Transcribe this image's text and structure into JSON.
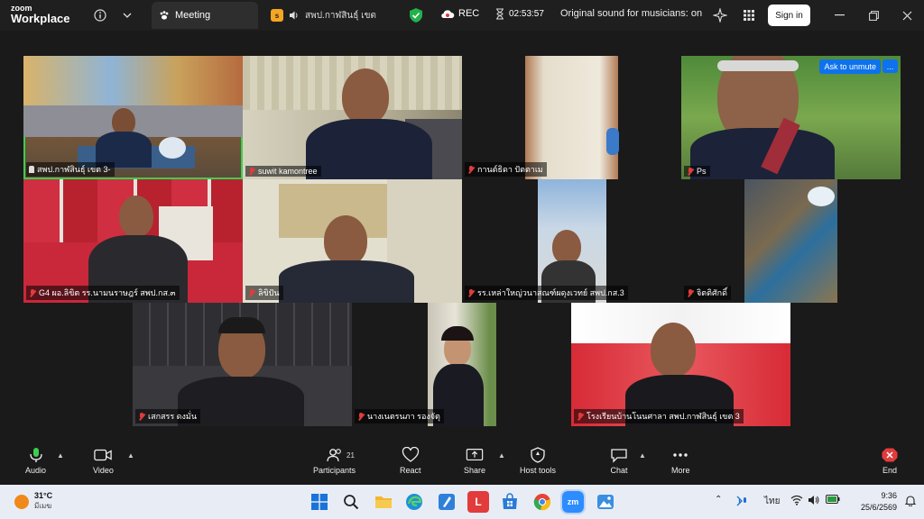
{
  "app": {
    "brand_top": "zoom",
    "brand_bottom": "Workplace"
  },
  "titlebar": {
    "meeting_tab": "Meeting",
    "share_tab": "สพป.กาฬสินธุ์ เขต",
    "rec_label": "REC",
    "timer": "02:53:57",
    "sound_label": "Original sound for musicians: on",
    "signin_label": "Sign in"
  },
  "tiles": {
    "t1": "สพป.กาฬสินธุ์ เขต 3-",
    "t2": "suwit kamontree",
    "t3": "กานต์ธิดา ปัตตาเม",
    "t4": "Ps",
    "t5": "G4 ผอ.ลิขิต รร.นามนราษฎร์ สพป.กส.๓",
    "t6": "ลิขิปัน",
    "t7": "รร.เหล่าใหญ่วนาสณฑ์ผดุงเวทย์ สพป.กส.3",
    "t8": "จิตติศักดิ์",
    "t9": "เสกสรร ดงมั่น",
    "t10": "นางเนตรนภา รองจัตุ",
    "t11": "โรงเรียนบ้านโนนศาลา สพป.กาฬสินธุ์ เขต 3",
    "unmute_label": "Ask to unmute",
    "more_label": "..."
  },
  "toolbar": {
    "audio": "Audio",
    "video": "Video",
    "participants": "Participants",
    "participants_count": "21",
    "react": "React",
    "share": "Share",
    "host_tools": "Host tools",
    "chat": "Chat",
    "more": "More",
    "end": "End"
  },
  "taskbar": {
    "temp": "31°C",
    "weather": "มีเมฆ",
    "lang": "ไทย",
    "time": "9:36",
    "date": "25/6/2569",
    "l_icon": "L",
    "zm_icon": "zm"
  },
  "colors": {
    "accent": "#0e72ed",
    "active_speaker": "#3ccf4e",
    "muted": "#e03c3c",
    "end": "#e03c3c"
  }
}
